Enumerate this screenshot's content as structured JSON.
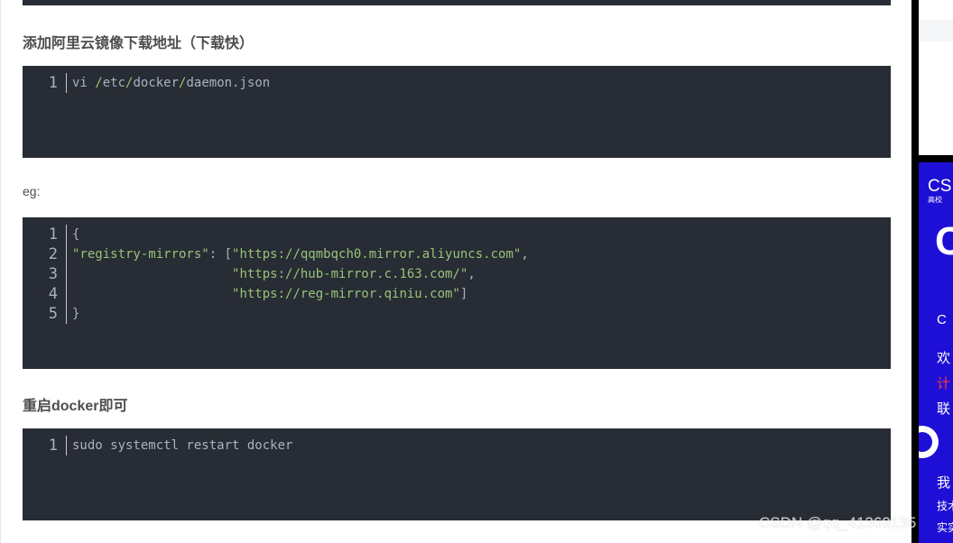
{
  "sections": {
    "heading_mirror": "添加阿里云镜像下载地址（下载快）",
    "eg_label": "eg:",
    "heading_restart": "重启docker即可"
  },
  "code1": {
    "line_numbers": [
      "1"
    ],
    "cmd": "vi ",
    "slash1": "/",
    "etc": "etc",
    "slash2": "/",
    "docker": "docker",
    "slash3": "/",
    "file": "daemon.json"
  },
  "code2": {
    "line_numbers": [
      "1",
      "2",
      "3",
      "4",
      "5"
    ],
    "l1": "{",
    "l2_key": "\"registry-mirrors\"",
    "l2_colon": ": [",
    "l2_str": "\"https://qqmbqch0.mirror.aliyuncs.com\"",
    "l2_comma": ",",
    "l3_indent": "                     ",
    "l3_str": "\"https://hub-mirror.c.163.com/\"",
    "l3_comma": ",",
    "l4_indent": "                     ",
    "l4_str": "\"https://reg-mirror.qiniu.com\"",
    "l4_close": "]",
    "l5": "}"
  },
  "code3": {
    "line_numbers": [
      "1"
    ],
    "l1": "sudo systemctl restart docker"
  },
  "ad": {
    "brand": "CS",
    "sub": "高校",
    "big": "C",
    "line_c": "C",
    "line1": "欢",
    "line2": "计",
    "line3": "联",
    "line4": "我",
    "line5": "技术",
    "line6": "实实"
  },
  "watermark": "CSDN @qq_41369135"
}
